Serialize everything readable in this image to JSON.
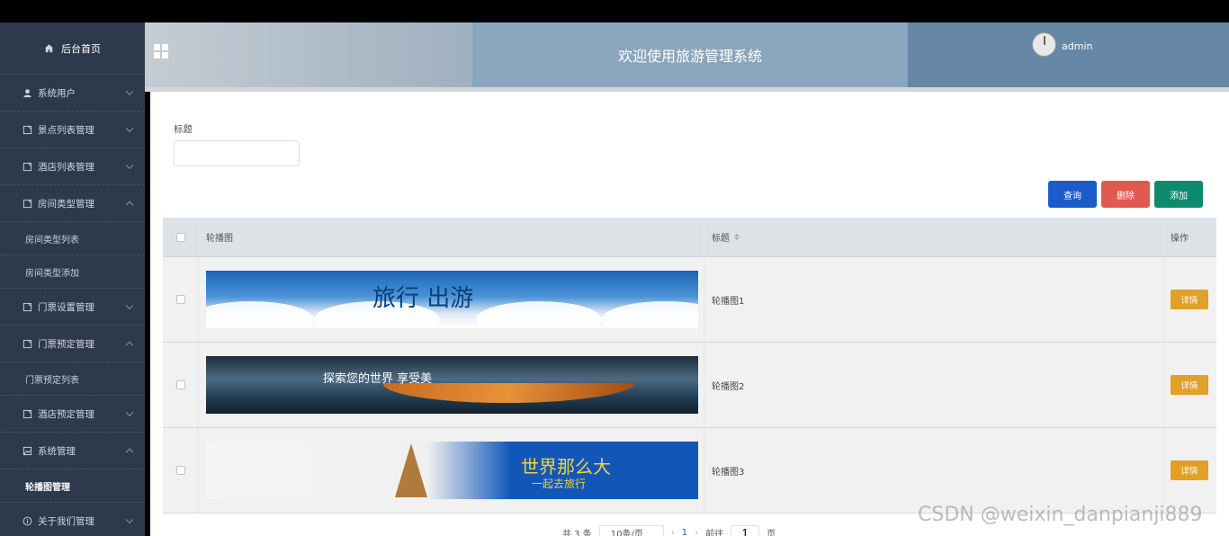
{
  "header": {
    "title": "欢迎使用旅游管理系统",
    "username": "admin"
  },
  "sidebar": {
    "home": "后台首页",
    "items": [
      {
        "label": "系统用户",
        "icon": "user-icon",
        "expanded": false
      },
      {
        "label": "景点列表管理",
        "icon": "doc-icon",
        "expanded": false
      },
      {
        "label": "酒店列表管理",
        "icon": "doc-icon",
        "expanded": false
      },
      {
        "label": "房间类型管理",
        "icon": "doc-icon",
        "expanded": true,
        "children": [
          "房间类型列表",
          "房间类型添加"
        ]
      },
      {
        "label": "门票设置管理",
        "icon": "doc-icon",
        "expanded": false
      },
      {
        "label": "门票预定管理",
        "icon": "doc-icon",
        "expanded": true,
        "children": [
          "门票预定列表"
        ]
      },
      {
        "label": "酒店预定管理",
        "icon": "doc-icon",
        "expanded": false
      },
      {
        "label": "系统管理",
        "icon": "image-icon",
        "expanded": true,
        "children": [
          "轮播图管理"
        ]
      },
      {
        "label": "关于我们管理",
        "icon": "info-icon",
        "expanded": false
      }
    ]
  },
  "search": {
    "label": "标题",
    "value": ""
  },
  "buttons": {
    "query": "查询",
    "delete": "删除",
    "add": "添加"
  },
  "table": {
    "columns": [
      "轮播图",
      "标题",
      "操作"
    ],
    "rows": [
      {
        "banner_text": "旅行  出游",
        "title": "轮播图1",
        "action": "详情"
      },
      {
        "banner_text": "探索您的世界 享受美",
        "title": "轮播图2",
        "action": "详情"
      },
      {
        "banner_text": "世界那么大",
        "banner_sub": "一起去旅行",
        "title": "轮播图3",
        "action": "详情"
      }
    ]
  },
  "pagination": {
    "total": "共 3 条",
    "page_size": "10条/页",
    "current": "1",
    "goto_label": "前往",
    "goto_value": "1",
    "page_unit": "页"
  },
  "watermark": "CSDN @weixin_danpianji889",
  "colors": {
    "sidebar_bg": "#2d3a4b",
    "query_btn": "#1a5cc9",
    "delete_btn": "#e05a4f",
    "add_btn": "#0e8a6f",
    "detail_btn": "#e0a126"
  }
}
